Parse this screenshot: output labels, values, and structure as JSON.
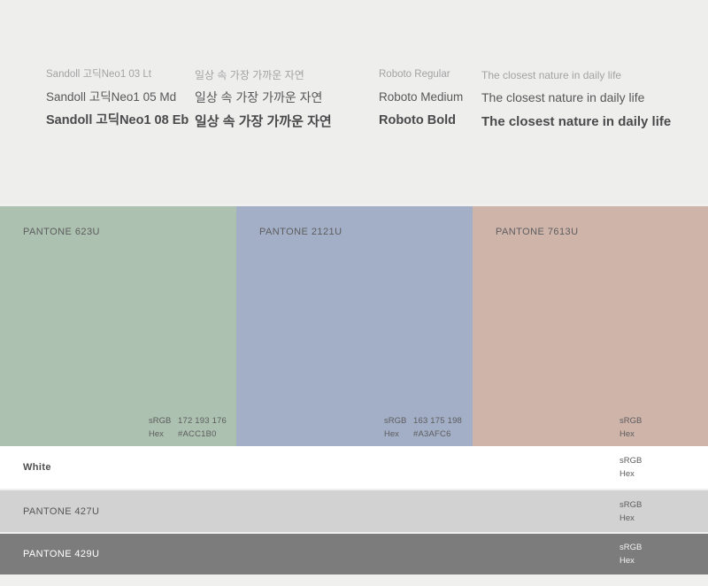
{
  "typography": {
    "columns": [
      {
        "id": "sandoll-names",
        "lines": [
          "Sandoll 고딕Neo1 03 Lt",
          "Sandoll 고딕Neo1 05 Md",
          "Sandoll 고딕Neo1 08 Eb"
        ]
      },
      {
        "id": "korean-samples",
        "lines": [
          "일상 속 가장 가까운 자연",
          "일상 속 가장 가까운 자연",
          "일상 속 가장 가까운 자연"
        ]
      },
      {
        "id": "roboto-names",
        "lines": [
          "Roboto Regular",
          "Roboto Medium",
          "Roboto Bold"
        ]
      },
      {
        "id": "english-samples",
        "lines": [
          "The closest nature in daily life",
          "The closest nature in daily life",
          "The closest nature in daily life"
        ]
      }
    ]
  },
  "labels": {
    "srgb": "sRGB",
    "hex": "Hex"
  },
  "swatches": [
    {
      "name": "PANTONE 623U",
      "srgb": "172 193 176",
      "hex": "#ACC1B0",
      "swatch_color": "#acc1b0",
      "text_color": "#5d5d5f"
    },
    {
      "name": "PANTONE 2121U",
      "srgb": "163 175 198",
      "hex": "#A3AFC6",
      "swatch_color": "#a3afc6",
      "text_color": "#5d5d5f"
    },
    {
      "name": "PANTONE 7613U",
      "srgb": "",
      "hex": "",
      "swatch_color": "#cfb4aa",
      "text_color": "#5d5d5f"
    }
  ],
  "rows": [
    {
      "name": "White",
      "srgb": "",
      "hex": "",
      "swatch_color": "#ffffff",
      "text_color": "#4d4d4f"
    },
    {
      "name": "PANTONE 427U",
      "srgb": "",
      "hex": "",
      "swatch_color": "#d2d2d2",
      "text_color": "#555557"
    },
    {
      "name": "PANTONE 429U",
      "srgb": "",
      "hex": "",
      "swatch_color": "#7c7c7c",
      "text_color": "#ffffff"
    }
  ]
}
